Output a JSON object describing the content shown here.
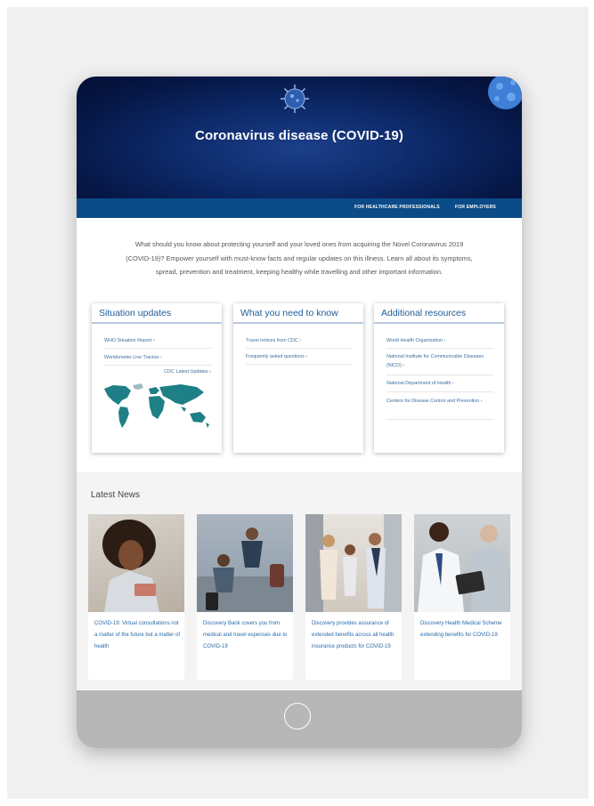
{
  "hero": {
    "title": "Coronavirus disease (COVID-19)"
  },
  "nav": {
    "items": [
      "FOR HEALTHCARE PROFESSIONALS",
      "FOR EMPLOYERS"
    ]
  },
  "intro": {
    "line1": "What should you know about protecting yourself and your loved ones from acquiring the Novel Coronavirus 2019",
    "line2": "(COVID-19)? Empower yourself with must-know facts and regular updates on this illness. Learn all about its symptoms,",
    "line3": "spread, prevention and treatment, keeping healthy while travelling and other important information."
  },
  "cards": [
    {
      "title": "Situation updates",
      "links": [
        "WHO Situation Report ›",
        "Worldometer Live Tracker ›",
        "CDC Latest Updates ›"
      ]
    },
    {
      "title": "What you need to know",
      "links": [
        "Travel notices from CDC ›",
        "Frequently asked questions ›"
      ]
    },
    {
      "title": "Additional resources",
      "links": [
        "World Health Organization ›",
        "National Institute for Communicable Diseases (NICD) ›",
        "National Department of Health ›",
        "Centers for Disease Control and Prevention ›"
      ]
    }
  ],
  "news": {
    "heading": "Latest News",
    "items": [
      "COVID-19: Virtual consultations not a matter of the future but a matter of health",
      "Discovery Bank covers you from medical and travel expenses due to COVID-19",
      "Discovery provides assurance of extended benefits across all health insurance products for COVID-19",
      "Discovery Health Medical Scheme extending benefits for COVID-19"
    ]
  },
  "colors": {
    "nav": "#0b4b88",
    "accent": "#1f5c99",
    "link": "#2a6aa8",
    "map": "#1e7f86"
  }
}
